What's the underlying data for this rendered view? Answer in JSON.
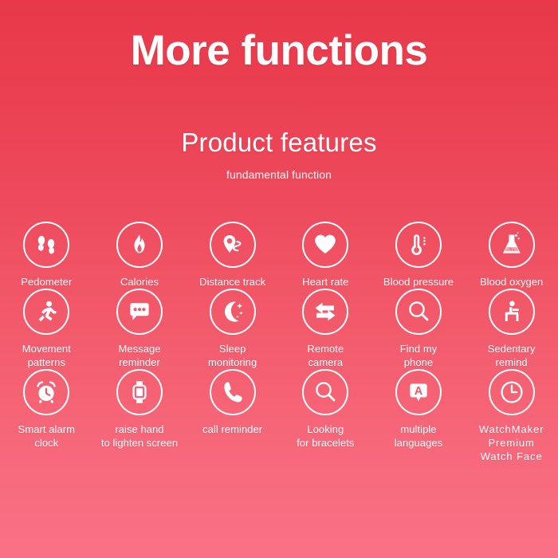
{
  "hero": {
    "title": "More functions"
  },
  "section": {
    "title": "Product features",
    "subtitle": "fundamental function"
  },
  "colors": {
    "gradient_top": "#E8384A",
    "gradient_mid": "#EE4B5E",
    "gradient_bottom": "#FA7186",
    "text": "#FFFFFF",
    "icon_stroke": "#FFFFFF"
  },
  "features": [
    {
      "label": "Pedometer",
      "icon": "footprints-icon"
    },
    {
      "label": "Calories",
      "icon": "flame-icon"
    },
    {
      "label": "Distance track",
      "icon": "map-pin-route-icon"
    },
    {
      "label": "Heart rate",
      "icon": "heart-icon"
    },
    {
      "label": "Blood pressure",
      "icon": "thermometer-icon"
    },
    {
      "label": "Blood oxygen",
      "icon": "flask-icon"
    },
    {
      "label": "Movement\npatterns",
      "icon": "running-person-icon"
    },
    {
      "label": "Message\nreminder",
      "icon": "chat-bubble-icon"
    },
    {
      "label": "Sleep\nmonitoring",
      "icon": "moon-stars-icon"
    },
    {
      "label": "Remote\ncamera",
      "icon": "double-arrow-icon"
    },
    {
      "label": "Find my\nphone",
      "icon": "magnifier-icon"
    },
    {
      "label": "Sedentary\nremind",
      "icon": "seated-person-icon"
    },
    {
      "label": "Smart alarm\nclock",
      "icon": "alarm-clock-icon"
    },
    {
      "label": "raise hand\nto lighten screen",
      "icon": "smartwatch-icon"
    },
    {
      "label": "call reminder",
      "icon": "phone-handset-icon"
    },
    {
      "label": "Looking\nfor bracelets",
      "icon": "magnifier-icon"
    },
    {
      "label": "multiple\nlanguages",
      "icon": "language-badge-icon"
    },
    {
      "label": "WatchMaker\nPremium\nWatch Face",
      "icon": "clock-face-icon"
    }
  ]
}
